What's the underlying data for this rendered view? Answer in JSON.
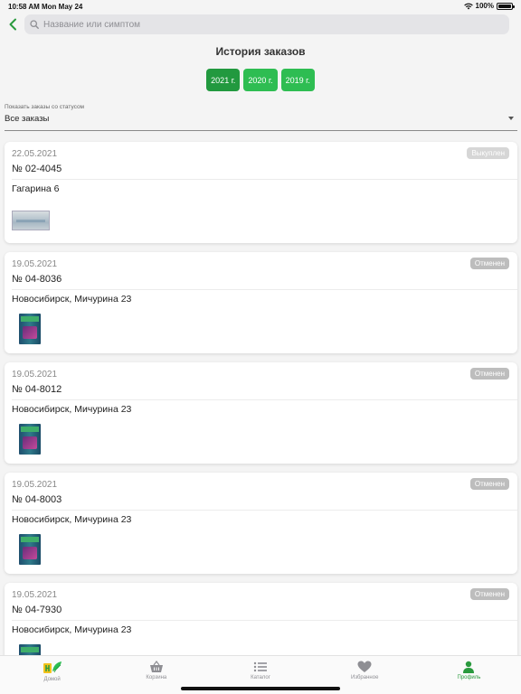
{
  "status_bar": {
    "time": "10:58 AM",
    "date": "Mon May 24",
    "battery": "100%"
  },
  "search": {
    "placeholder": "Название или симптом"
  },
  "page": {
    "title": "История заказов"
  },
  "years": [
    {
      "label": "2021 г.",
      "selected": true
    },
    {
      "label": "2020 г.",
      "selected": false
    },
    {
      "label": "2019 г.",
      "selected": false
    }
  ],
  "filter": {
    "label": "Показать заказы со статусом",
    "value": "Все заказы"
  },
  "orders": [
    {
      "date": "22.05.2021",
      "status": "Выкуплен",
      "number": "№ 02-4045",
      "address": "Гагарина 6",
      "thumb_icon": "medical-mask-thumb"
    },
    {
      "date": "19.05.2021",
      "status": "Отменен",
      "number": "№ 04-8036",
      "address": "Новосибирск, Мичурина 23",
      "thumb_icon": "product-box-thumb"
    },
    {
      "date": "19.05.2021",
      "status": "Отменен",
      "number": "№ 04-8012",
      "address": "Новосибирск, Мичурина 23",
      "thumb_icon": "product-box-thumb"
    },
    {
      "date": "19.05.2021",
      "status": "Отменен",
      "number": "№ 04-8003",
      "address": "Новосибирск, Мичурина 23",
      "thumb_icon": "product-box-thumb"
    },
    {
      "date": "19.05.2021",
      "status": "Отменен",
      "number": "№ 04-7930",
      "address": "Новосибирск, Мичурина 23",
      "thumb_icon": "product-box-thumb"
    }
  ],
  "tabs": [
    {
      "label": "Домой",
      "icon": "home-logo-icon",
      "active": false
    },
    {
      "label": "Корзина",
      "icon": "basket-icon",
      "active": false
    },
    {
      "label": "Каталог",
      "icon": "list-icon",
      "active": false
    },
    {
      "label": "Избранное",
      "icon": "heart-icon",
      "active": false
    },
    {
      "label": "Профиль",
      "icon": "person-icon",
      "active": true
    }
  ],
  "colors": {
    "accent": "#2ebd52",
    "accent_active": "#22993f",
    "badge": "#bdbdbd",
    "tab_active": "#2a9a3e"
  }
}
